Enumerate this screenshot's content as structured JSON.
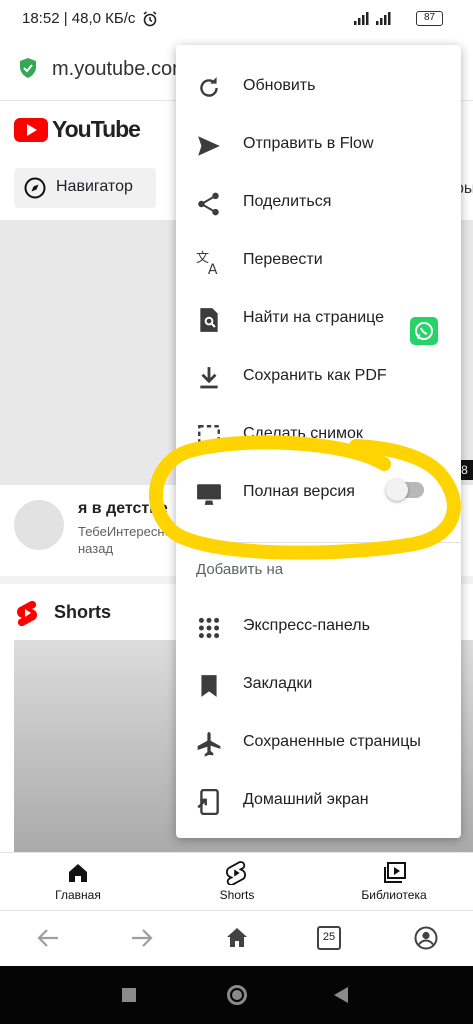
{
  "status_bar": {
    "time_speed": "18:52 | 48,0 КБ/с",
    "battery": "87"
  },
  "url_bar": {
    "url": "m.youtube.com"
  },
  "youtube": {
    "logo_text": "YouTube",
    "navigator_chip": "Навигатор",
    "partial_chip": "ры",
    "video": {
      "title": "я в детстве",
      "channel": "ТебеИнтересно",
      "age": "назад",
      "badge": "8"
    },
    "shorts_heading": "Shorts",
    "bottom_nav": [
      {
        "label": "Главная"
      },
      {
        "label": "Shorts"
      },
      {
        "label": "Библиотека"
      }
    ]
  },
  "browser_bar": {
    "tab_count": "25"
  },
  "menu": {
    "items": [
      {
        "label": "Обновить",
        "icon": "refresh-icon"
      },
      {
        "label": "Отправить в Flow",
        "icon": "send-icon"
      },
      {
        "label": "Поделиться",
        "icon": "share-icon"
      },
      {
        "label": "Перевести",
        "icon": "translate-icon"
      },
      {
        "label": "Найти на странице",
        "icon": "find-in-page-icon"
      },
      {
        "label": "Сохранить как PDF",
        "icon": "download-icon"
      },
      {
        "label": "Сделать снимок",
        "icon": "screenshot-icon"
      },
      {
        "label": "Полная версия",
        "icon": "desktop-icon",
        "toggle": false
      }
    ],
    "section_label": "Добавить на",
    "add_items": [
      {
        "label": "Экспресс-панель",
        "icon": "speed-dial-icon"
      },
      {
        "label": "Закладки",
        "icon": "bookmark-icon"
      },
      {
        "label": "Сохраненные страницы",
        "icon": "airplane-icon"
      },
      {
        "label": "Домашний экран",
        "icon": "home-screen-icon"
      }
    ]
  },
  "colors": {
    "youtube_red": "#ff0000",
    "highlight": "#ffd400",
    "whatsapp": "#25d366",
    "secure_green": "#34a853"
  }
}
